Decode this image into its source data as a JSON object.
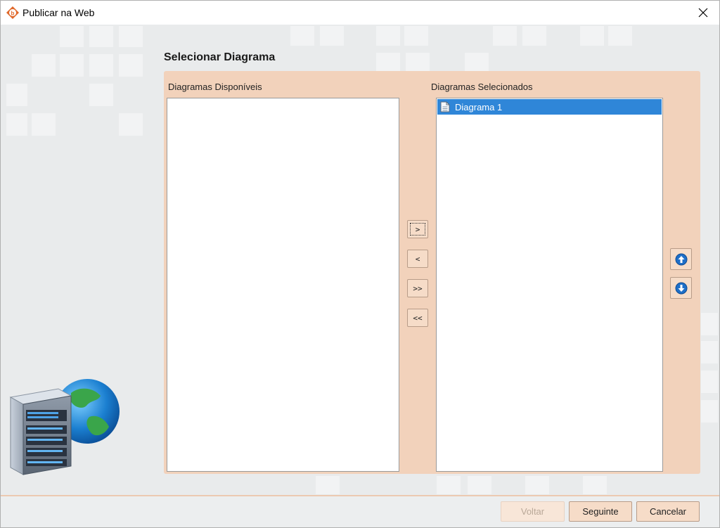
{
  "window": {
    "title": "Publicar na Web"
  },
  "main": {
    "section_title": "Selecionar Diagrama",
    "available": {
      "label": "Diagramas Disponíveis",
      "items": []
    },
    "selected": {
      "label": "Diagramas Selecionados",
      "items": [
        "Diagrama 1"
      ]
    },
    "move_buttons": {
      "add": ">",
      "remove": "<",
      "add_all": ">>",
      "remove_all": "<<"
    }
  },
  "footer": {
    "back_label": "Voltar",
    "next_label": "Seguinte",
    "cancel_label": "Cancelar"
  },
  "icons": {
    "app": "app-logo-icon",
    "close": "close-icon",
    "document": "document-icon",
    "up": "arrow-up-icon",
    "down": "arrow-down-icon",
    "illustration": "server-globe-illustration"
  },
  "colors": {
    "panel": "#f2d2bb",
    "selection": "#2f86d8",
    "button": "#f6dcc8"
  }
}
